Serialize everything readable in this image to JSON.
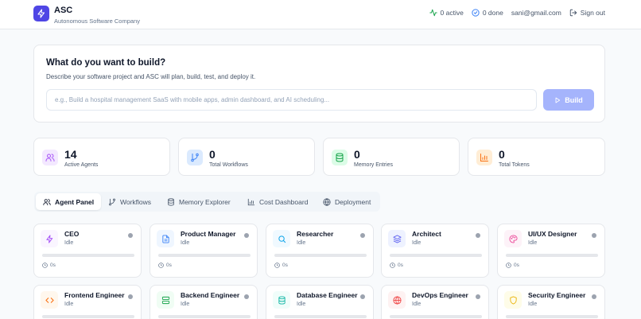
{
  "app": {
    "title": "ASC",
    "subtitle": "Autonomous Software Company"
  },
  "header": {
    "active_text": "0 active",
    "done_text": "0 done",
    "email": "sani@gmail.com",
    "signout_label": "Sign out"
  },
  "build": {
    "title": "What do you want to build?",
    "description": "Describe your software project and ASC will plan, build, test, and deploy it.",
    "placeholder": "e.g., Build a hospital management SaaS with mobile apps, admin dashboard, and AI scheduling...",
    "value": "",
    "button_label": "Build"
  },
  "stats": [
    {
      "value": "14",
      "label": "Active Agents",
      "icon": "users-icon",
      "color": "#a855f7"
    },
    {
      "value": "0",
      "label": "Total Workflows",
      "icon": "git-branch-icon",
      "color": "#3b82f6"
    },
    {
      "value": "0",
      "label": "Memory Entries",
      "icon": "database-icon",
      "color": "#16a34a"
    },
    {
      "value": "0",
      "label": "Total Tokens",
      "icon": "bar-chart-icon",
      "color": "#f97316"
    }
  ],
  "tabs": [
    {
      "label": "Agent Panel",
      "icon": "users-icon",
      "active": true
    },
    {
      "label": "Workflows",
      "icon": "git-branch-icon",
      "active": false
    },
    {
      "label": "Memory Explorer",
      "icon": "database-icon",
      "active": false
    },
    {
      "label": "Cost Dashboard",
      "icon": "bar-chart-icon",
      "active": false
    },
    {
      "label": "Deployment",
      "icon": "globe-icon",
      "active": false
    }
  ],
  "agents": [
    {
      "name": "CEO",
      "status": "Idle",
      "time": "0s",
      "progress": 0,
      "icon": "zap-icon",
      "color": "#a855f7"
    },
    {
      "name": "Product Manager",
      "status": "Idle",
      "time": "0s",
      "progress": 0,
      "icon": "file-icon",
      "color": "#3b82f6"
    },
    {
      "name": "Researcher",
      "status": "Idle",
      "time": "0s",
      "progress": 0,
      "icon": "search-icon",
      "color": "#0ea5e9"
    },
    {
      "name": "Architect",
      "status": "Idle",
      "time": "0s",
      "progress": 0,
      "icon": "layers-icon",
      "color": "#6366f1"
    },
    {
      "name": "UI/UX Designer",
      "status": "Idle",
      "time": "0s",
      "progress": 0,
      "icon": "palette-icon",
      "color": "#ec4899"
    },
    {
      "name": "Frontend Engineer",
      "status": "Idle",
      "icon": "code-icon",
      "color": "#f97316"
    },
    {
      "name": "Backend Engineer",
      "status": "Idle",
      "icon": "server-icon",
      "color": "#16a34a"
    },
    {
      "name": "Database Engineer",
      "status": "Idle",
      "icon": "database-icon",
      "color": "#14b8a6"
    },
    {
      "name": "DevOps Engineer",
      "status": "Idle",
      "icon": "globe-icon",
      "color": "#ef4444"
    },
    {
      "name": "Security Engineer",
      "status": "Idle",
      "icon": "shield-icon",
      "color": "#eab308"
    }
  ]
}
